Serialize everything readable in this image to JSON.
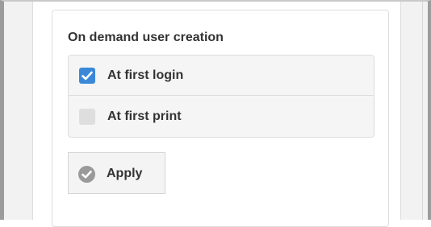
{
  "section": {
    "title": "On demand user creation"
  },
  "options": [
    {
      "label": "At first login",
      "checked": true,
      "icon": "checkbox-checked-icon"
    },
    {
      "label": "At first print",
      "checked": false,
      "icon": "checkbox-unchecked-icon"
    }
  ],
  "apply_button": {
    "label": "Apply",
    "icon": "check-circle-icon"
  },
  "colors": {
    "checkbox_checked": "#3b88d8",
    "checkbox_unchecked": "#dedede",
    "apply_icon": "#9a9a9a"
  }
}
